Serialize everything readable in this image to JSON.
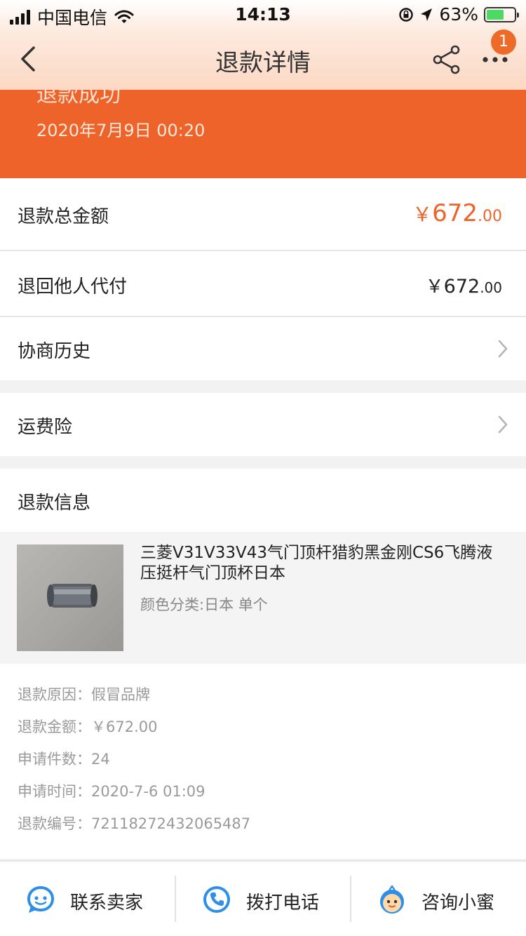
{
  "status_bar": {
    "carrier": "中国电信",
    "time": "14:13",
    "battery_pct": "63%",
    "battery_level": 0.63
  },
  "nav": {
    "title": "退款详情",
    "more_badge": "1",
    "icons": [
      "back-arrow-icon",
      "share-icon",
      "more-dots-icon"
    ]
  },
  "banner": {
    "status": "退款成功",
    "date": "2020年7月9日 00:20"
  },
  "summary": {
    "total_label": "退款总金额",
    "total_yen": "￥",
    "total_int": "672",
    "total_dec": ".00",
    "other_label": "退回他人代付",
    "other_yen": "￥",
    "other_int": "672",
    "other_dec": ".00",
    "history_label": "协商历史",
    "freight_label": "运费险"
  },
  "refund_info": {
    "heading": "退款信息",
    "product_title": "三菱V31V33V43气门顶杆猎豹黑金刚CS6飞腾液压挺杆气门顶杯日本",
    "product_sku": "颜色分类:日本 单个",
    "details": [
      {
        "label": "退款原因：",
        "value": "假冒品牌"
      },
      {
        "label": "退款金额：",
        "value": "￥672.00"
      },
      {
        "label": "申请件数：",
        "value": "24"
      },
      {
        "label": "申请时间：",
        "value": "2020-7-6 01:09"
      },
      {
        "label": "退款编号：",
        "value": "72118272432065487"
      }
    ]
  },
  "toolbar": {
    "contact_label": "联系卖家",
    "call_label": "拨打电话",
    "assistant_label": "咨询小蜜",
    "icons": [
      "seller-chat-icon",
      "phone-icon",
      "assistant-icon"
    ]
  },
  "colors": {
    "accent": "#ee632a",
    "icon_blue": "#2d8fe6"
  }
}
